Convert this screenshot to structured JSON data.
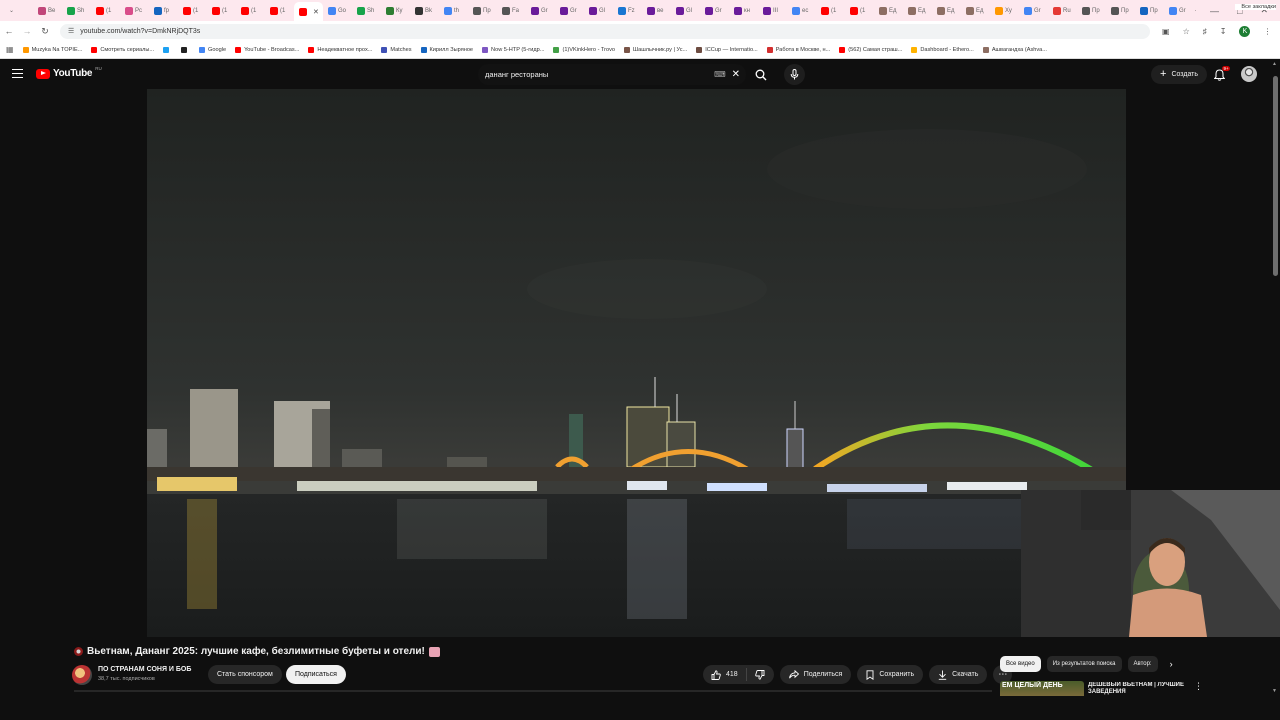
{
  "browser": {
    "tabs": [
      {
        "label": "Ве",
        "color": "#c1477a"
      },
      {
        "label": "Sh",
        "color": "#17a34a"
      },
      {
        "label": "(1",
        "color": "#ff0000"
      },
      {
        "label": "Pc",
        "color": "#d94d8a"
      },
      {
        "label": "fp",
        "color": "#1565c0"
      },
      {
        "label": "(1",
        "color": "#ff0000"
      },
      {
        "label": "(1",
        "color": "#ff0000"
      },
      {
        "label": "(1",
        "color": "#ff0000"
      },
      {
        "label": "(1",
        "color": "#ff0000"
      },
      {
        "label": "",
        "color": "#ff0000",
        "active": true
      },
      {
        "label": "Go",
        "color": "#4285f4"
      },
      {
        "label": "Sh",
        "color": "#17a34a"
      },
      {
        "label": "Ку",
        "color": "#2e7d32"
      },
      {
        "label": "Bk",
        "color": "#333333"
      },
      {
        "label": "th",
        "color": "#4285f4"
      },
      {
        "label": "Пр",
        "color": "#555555"
      },
      {
        "label": "Fa",
        "color": "#555555"
      },
      {
        "label": "Gr",
        "color": "#6a1b9a"
      },
      {
        "label": "Gr",
        "color": "#6a1b9a"
      },
      {
        "label": "Gl",
        "color": "#6a1b9a"
      },
      {
        "label": "Fz",
        "color": "#1976d2"
      },
      {
        "label": "ве",
        "color": "#6a1b9a"
      },
      {
        "label": "Gl",
        "color": "#6a1b9a"
      },
      {
        "label": "Gr",
        "color": "#6a1b9a"
      },
      {
        "label": "кн",
        "color": "#6a1b9a"
      },
      {
        "label": "III",
        "color": "#6a1b9a"
      },
      {
        "label": "ес",
        "color": "#4285f4"
      },
      {
        "label": "(1",
        "color": "#ff0000"
      },
      {
        "label": "(1",
        "color": "#ff0000"
      },
      {
        "label": "Ед",
        "color": "#8d6e63"
      },
      {
        "label": "Ед",
        "color": "#8d6e63"
      },
      {
        "label": "Ед",
        "color": "#8d6e63"
      },
      {
        "label": "Ед",
        "color": "#8d6e63"
      },
      {
        "label": "Ху",
        "color": "#ff9800"
      },
      {
        "label": "Gr",
        "color": "#4285f4"
      },
      {
        "label": "Ru",
        "color": "#e53935"
      },
      {
        "label": "Пр",
        "color": "#555555"
      },
      {
        "label": "Пр",
        "color": "#555555"
      },
      {
        "label": "Пр",
        "color": "#1565c0"
      },
      {
        "label": "Gr",
        "color": "#4285f4"
      }
    ],
    "url": "youtube.com/watch?v=DmkNRjDQT3s",
    "bookmarks": [
      {
        "label": "Muzyka Na TOPIE...",
        "color": "#ff9800"
      },
      {
        "label": "Смотреть сериалы...",
        "color": "#ff0000"
      },
      {
        "label": "",
        "color": "#1da1f2"
      },
      {
        "label": "",
        "color": "#222222"
      },
      {
        "label": "Google",
        "color": "#4285f4"
      },
      {
        "label": "YouTube - Broadcas...",
        "color": "#ff0000"
      },
      {
        "label": "Неадекватное прох...",
        "color": "#ff0000"
      },
      {
        "label": "Matches",
        "color": "#3f51b5"
      },
      {
        "label": "Кирилл Зыряное",
        "color": "#1565c0"
      },
      {
        "label": "Now 5-HTP (5-гидр...",
        "color": "#7e57c2"
      },
      {
        "label": "(1)VKinkHero - Trovo",
        "color": "#43a047"
      },
      {
        "label": "Шашлычник.ру | Ус...",
        "color": "#795548"
      },
      {
        "label": "ICCup — Internatio...",
        "color": "#6d4c41"
      },
      {
        "label": "Работа в Москве, н...",
        "color": "#d32f2f"
      },
      {
        "label": "(562) Самая страш...",
        "color": "#ff0000"
      },
      {
        "label": "Dashboard - Ethero...",
        "color": "#ffb300"
      },
      {
        "label": "Ашвагандха (Ashva...",
        "color": "#8d6e63"
      }
    ],
    "all_bookmarks": "Все закладки"
  },
  "youtube": {
    "logo": "YouTube",
    "region": "RU",
    "search_query": "дананг рестораны",
    "create_label": "Создать",
    "notification_count": "9+"
  },
  "video": {
    "title": "Вьетнам, Дананг 2025: лучшие кафе, безлимитные буфеты и отели!",
    "channel": "ПО СТРАНАМ СОНЯ И БОБ",
    "subscribers": "38,7 тыс. подписчиков",
    "sponsor_label": "Стать спонсором",
    "subscribe_label": "Подписаться",
    "likes": "418",
    "share_label": "Поделиться",
    "save_label": "Сохранить",
    "download_label": "Скачать"
  },
  "sidebar": {
    "chips": [
      "Все видео",
      "Из результатов поиска",
      "Автор: "
    ],
    "recommendation": {
      "thumb_text": "ЕМ ЦЕЛЫЙ ДЕНЬ",
      "title": "ДЕШЕВЫЙ ВЬЕТНАМ | ЛУЧШИЕ ЗАВЕДЕНИЯ"
    }
  }
}
